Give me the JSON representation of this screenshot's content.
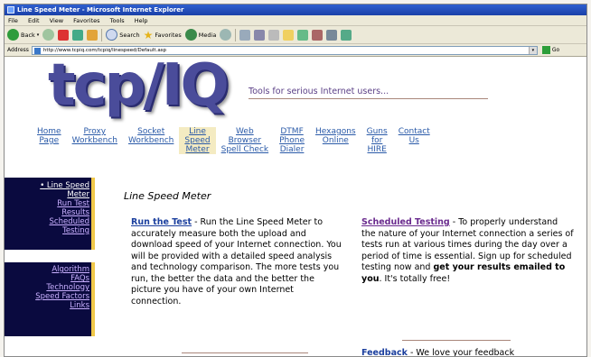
{
  "window": {
    "title": "Line Speed Meter - Microsoft Internet Explorer"
  },
  "menu": [
    "File",
    "Edit",
    "View",
    "Favorites",
    "Tools",
    "Help"
  ],
  "toolbar": {
    "back": "Back",
    "search": "Search",
    "favorites": "Favorites",
    "media": "Media"
  },
  "address": {
    "label": "Address",
    "url": "http://www.tcpiq.com/tcpiq/linespeed/Default.asp",
    "go": "Go"
  },
  "site": {
    "logo": "tcp/IQ",
    "tagline": "Tools for serious Internet users..."
  },
  "nav": [
    {
      "line1": "Home",
      "line2": "Page",
      "line3": ""
    },
    {
      "line1": "Proxy",
      "line2": "Workbench",
      "line3": ""
    },
    {
      "line1": "Socket",
      "line2": "Workbench",
      "line3": ""
    },
    {
      "line1": "Line",
      "line2": "Speed",
      "line3": "Meter"
    },
    {
      "line1": "Web",
      "line2": "Browser",
      "line3": "Spell Check"
    },
    {
      "line1": "DTMF",
      "line2": "Phone",
      "line3": "Dialer"
    },
    {
      "line1": "Hexagons",
      "line2": "Online",
      "line3": ""
    },
    {
      "line1": "Guns",
      "line2": "for",
      "line3": "HIRE"
    },
    {
      "line1": "Contact",
      "line2": "Us",
      "line3": ""
    }
  ],
  "sidebar": {
    "group1": [
      "• Line Speed",
      "Meter",
      "Run Test",
      "Results",
      "Scheduled",
      "Testing"
    ],
    "group2": [
      "Algorithm",
      "FAQs",
      "Technology",
      "Speed Factors",
      "Links"
    ]
  },
  "main": {
    "title": "Line Speed Meter",
    "run_link": "Run the Test",
    "run_text": " - Run the Line Speed Meter to accurately measure both the upload and download speed of your Internet connection. You will be provided with a detailed speed analysis and technology comparison. The more tests you run, the better the data and the better the picture you have of your own Internet connection.",
    "sched_link": "Scheduled Testing",
    "sched_text": " - To properly understand the nature of your Internet connection a series of tests run at various times during the day over a period of time is essential. Sign up for scheduled testing now and ",
    "sched_bold": "get your results emailed to you",
    "sched_tail": ". It's totally free!",
    "feedback_link": "Feedback",
    "feedback_text": " - We love your feedback"
  }
}
